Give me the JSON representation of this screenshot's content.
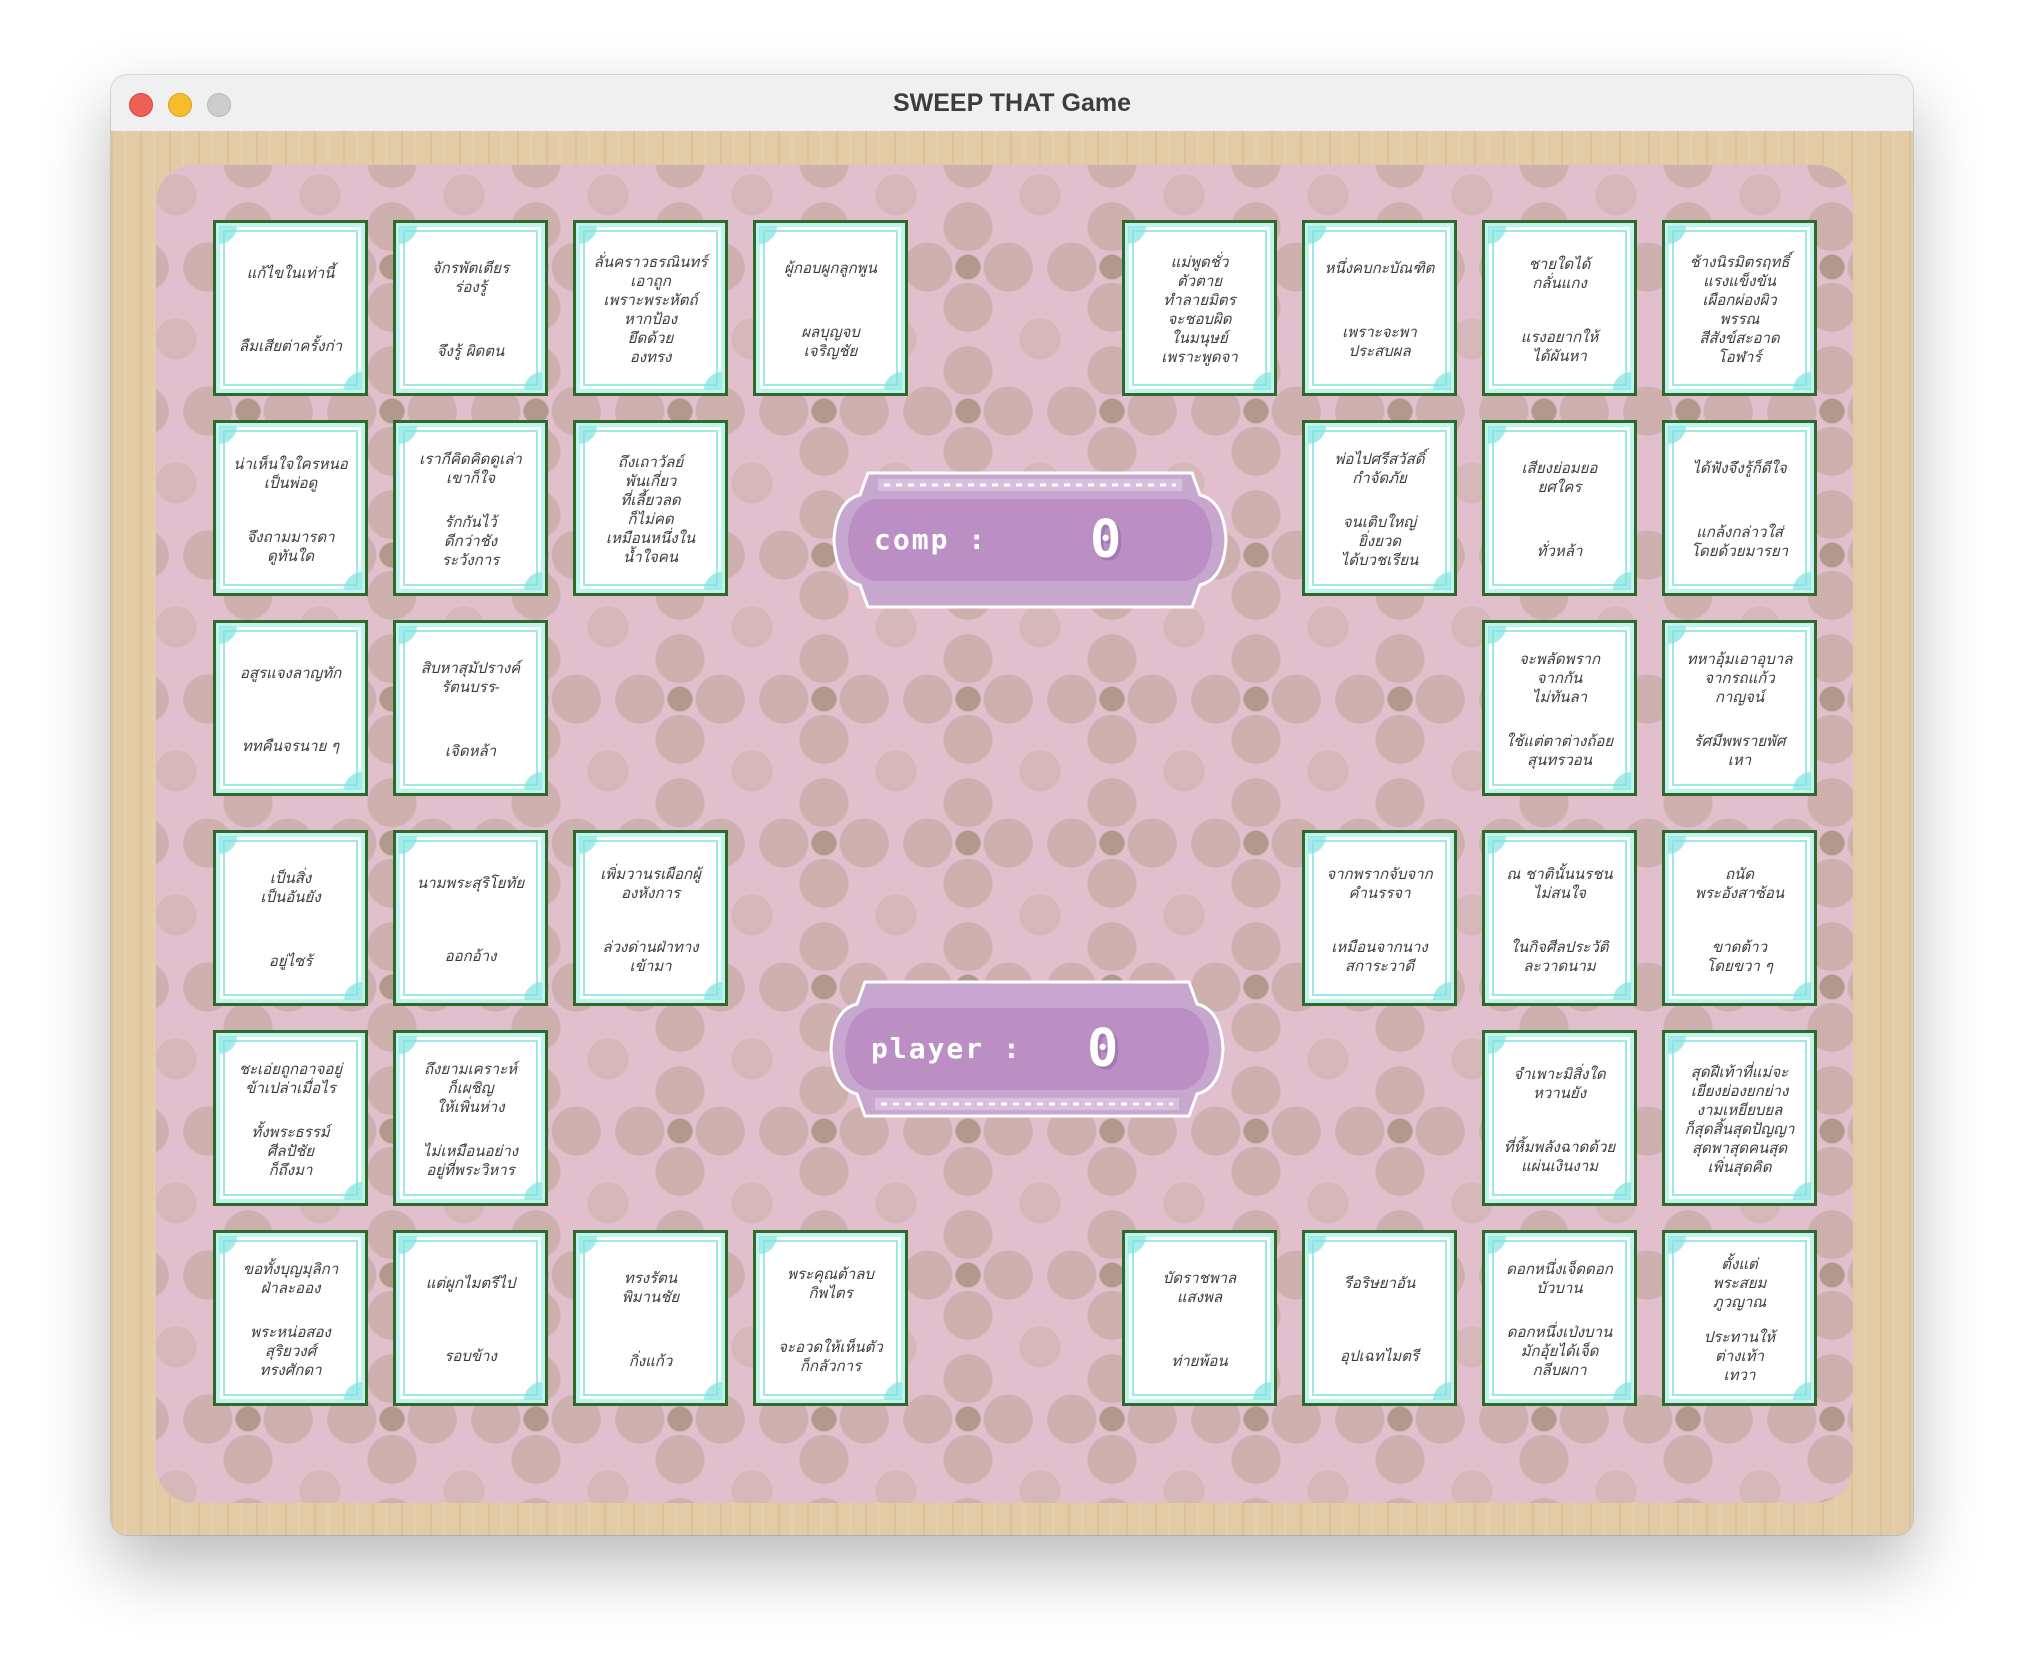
{
  "window": {
    "title": "SWEEP THAT Game"
  },
  "scores": {
    "comp": {
      "label": "comp :",
      "value": "0"
    },
    "player": {
      "label": "player :",
      "value": "0"
    }
  },
  "colors": {
    "board": "#e1bfcc",
    "frame": "#e3cba6",
    "panel": "#bb8fc3",
    "card_border": "#2f6a2a",
    "card_accent": "#9ee9e3"
  },
  "cards": [
    {
      "id": "c1",
      "lines": [
        "แก้ไขในเท่านี้",
        "ลืมเสียต่าครั้งก่า"
      ]
    },
    {
      "id": "c2",
      "lines": [
        "จักรพัตเตียร\nร่องรู้",
        "จึงรู้ ผิดตน"
      ]
    },
    {
      "id": "c3",
      "lines": [
        "ลั่นคราวธรณินทร์\nเอาถูก\nเพราะพระหัตถ์\nหากป้อง\nยึดด้วย\nองทรง"
      ]
    },
    {
      "id": "c4",
      "lines": [
        "ผู้กอบผูกลูกพูน",
        "ผลบุญจบ\nเจริญชัย"
      ]
    },
    {
      "id": "c5",
      "lines": [
        "แม่พูดชั่ว\nตัวตาย\nทำลายมิตร\nจะชอบผิด\nในมนุษย์\nเพราะพูดจา"
      ]
    },
    {
      "id": "c6",
      "lines": [
        "หนึ่งคบกะบัณฑิต",
        "เพราะจะพา\nประสบผล"
      ]
    },
    {
      "id": "c7",
      "lines": [
        "ชายใดได้\nกลั่นแกง",
        "แรงอยากให้\nได้ผันหา"
      ]
    },
    {
      "id": "c8",
      "lines": [
        "ช้างนิรมิตรฤทธิ์\nแรงแข็งขัน\nเผือกผ่องผิว\nพรรณ\nสีสังข์สะอาด\nโอฬาร์"
      ]
    },
    {
      "id": "c9",
      "lines": [
        "น่าเห็นใจใครหนอ\nเป็นพ่อดู",
        "จึงถามมารดา\nดูทันใด"
      ]
    },
    {
      "id": "c10",
      "lines": [
        "เรากีคิดคิดดูเล่า\nเขาก็ใจ",
        "รักกันไว้\nดีกว่าชัง\nระวังการ"
      ]
    },
    {
      "id": "c11",
      "lines": [
        "ถึงเถาวัลย์\nพันเกี่ยว\nที่เลี้ยวลด\nก็ไม่คด\nเหมือนหนึ่งใน\nน้ำใจคน"
      ]
    },
    {
      "id": "c12",
      "lines": [
        "พ่อไปศรีสวัสดิ์\nกำจัดภัย",
        "จนเติบใหญ่\nยิ่งยวด\nได้บวชเรียน"
      ]
    },
    {
      "id": "c13",
      "lines": [
        "เสียงย่อมยอ\nยศใคร",
        "ทั่วหล้า"
      ]
    },
    {
      "id": "c14",
      "lines": [
        "ได้ฟังจึงรู้ก็ดีใจ",
        "แกล้งกล่าวใส่\nโดยด้วยมารยา"
      ]
    },
    {
      "id": "c15",
      "lines": [
        "อสูรแจงลาญทัก",
        "ททคืนจรนาย ๆ"
      ]
    },
    {
      "id": "c16",
      "lines": [
        "สิบหาสุมัปรางค์\nรัตนบรร-",
        "เจิดหล้า"
      ]
    },
    {
      "id": "c17",
      "lines": [
        "จะพลัดพราก\nจากกัน\nไม่ทันลา",
        "ใช้แต่ตาต่างถ้อย\nสุนทรวอน"
      ]
    },
    {
      "id": "c18",
      "lines": [
        "ทหาอุ้มเอาอุบาล\nจากรถแก้ว\nกาญจน์",
        "รัศมีพพรายพัศ\nเหา"
      ]
    },
    {
      "id": "c19",
      "lines": [
        "เป็นสิ่ง\nเป็นอันยัง",
        "อยู่ไซร้"
      ]
    },
    {
      "id": "c20",
      "lines": [
        "นามพระสุริโยทัย",
        "ออกอ้าง"
      ]
    },
    {
      "id": "c21",
      "lines": [
        "เพิ่มวานรเผือกผู้\nองหังการ",
        "ล่วงด่านฝ่าทาง\nเข้ามา"
      ]
    },
    {
      "id": "c22",
      "lines": [
        "จากพรากจับจาก\nคำนรรจา",
        "เหมือนจากนาง\nสการะวาดี"
      ]
    },
    {
      "id": "c23",
      "lines": [
        "ณ ชาตินั้นนรชน\nไม่สนใจ",
        "ในกิจศีลประวัติ\nละวาดนาม"
      ]
    },
    {
      "id": "c24",
      "lines": [
        "ถนัด\nพระอังสาซ้อน",
        "ขาดต้าว\nโดยขวา ๆ"
      ]
    },
    {
      "id": "c25",
      "lines": [
        "ชะเอ่ยถูกอาจอยู่\nข้าเปล่าเมื่อไร",
        "ทั้งพระธรรม์\nศีลปัชัย\nก็ถึงมา"
      ]
    },
    {
      "id": "c26",
      "lines": [
        "ถึงยามเคราะห์\nก็เผชิญ\nให้เพิ่นห่าง",
        "ไม่เหมือนอย่าง\nอยู่ที่พระวิหาร"
      ]
    },
    {
      "id": "c27",
      "lines": [
        "จำเพาะมิสิ่งใด\nหวานยัง",
        "ที่หิ้มพลังฉาดด้วย\nแผ่นเงินงาม"
      ]
    },
    {
      "id": "c28",
      "lines": [
        "สุดฝีเท้าที่แม่จะ\nเยียงย่องยกย่าง\nงามเหยียบยล\nก็สุดสิ้นสุดปัญญา\nสุดพาสุดคนสุด\nเพิ่นสุดคิด"
      ]
    },
    {
      "id": "c29",
      "lines": [
        "ขอทั้งบุญมุลิกา\nฝ่าละออง",
        "พระหน่อสอง\nสุริยวงศ์\nทรงศักดา"
      ]
    },
    {
      "id": "c30",
      "lines": [
        "แต่ผูกไมตรีไป",
        "รอบข้าง"
      ]
    },
    {
      "id": "c31",
      "lines": [
        "ทรงรัตน\nพิมานชัย",
        "กิ่งแก้ว"
      ]
    },
    {
      "id": "c32",
      "lines": [
        "พระคุณต้าลบ\nกิพไตร",
        "จะอวดให้เห็นตัว\nก็กลัวการ"
      ]
    },
    {
      "id": "c33",
      "lines": [
        "บัดราชพาล\nแสงพล",
        "ท่ายพ้อน"
      ]
    },
    {
      "id": "c34",
      "lines": [
        "รีอริษยาอัน",
        "อุปเฉทไมตรี"
      ]
    },
    {
      "id": "c35",
      "lines": [
        "ดอกหนึ่งเจ็ดดอก\nบัวบาน",
        "ดอกหนึ่งเป่งบาน\nมักอุ้ยได้เจ็ด\nกลีบผกา"
      ]
    },
    {
      "id": "c36",
      "lines": [
        "ตั้งแต่\nพระสยม\nภูวญาณ",
        "ประทานให้\nต่างเท้า\nเทวา"
      ]
    }
  ]
}
